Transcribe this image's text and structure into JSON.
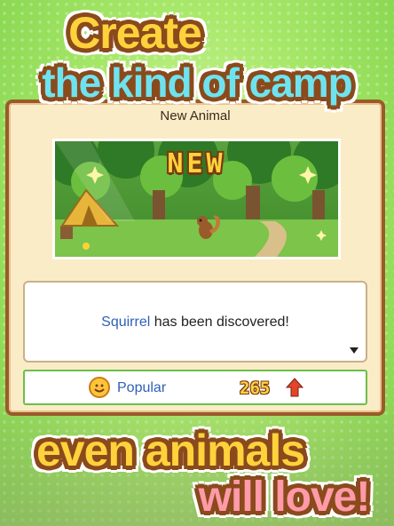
{
  "headline": {
    "line1": "Create",
    "line2": "the kind of camp",
    "line3": "even animals",
    "line4": "will love!"
  },
  "dialog": {
    "title": "New Animal",
    "scene_banner": "NEW",
    "message": {
      "animal_name": "Squirrel",
      "rest": " has been discovered!"
    },
    "status": {
      "label": "Popular",
      "value": "265",
      "icon": "smiley-icon",
      "trend_icon": "up-arrow-icon"
    }
  },
  "colors": {
    "accent_yellow": "#ffd23c",
    "accent_cyan": "#6ee3f0",
    "accent_pink": "#ff9aa8",
    "outline_brown": "#8a4a1c",
    "link_blue": "#2f5fb8"
  }
}
